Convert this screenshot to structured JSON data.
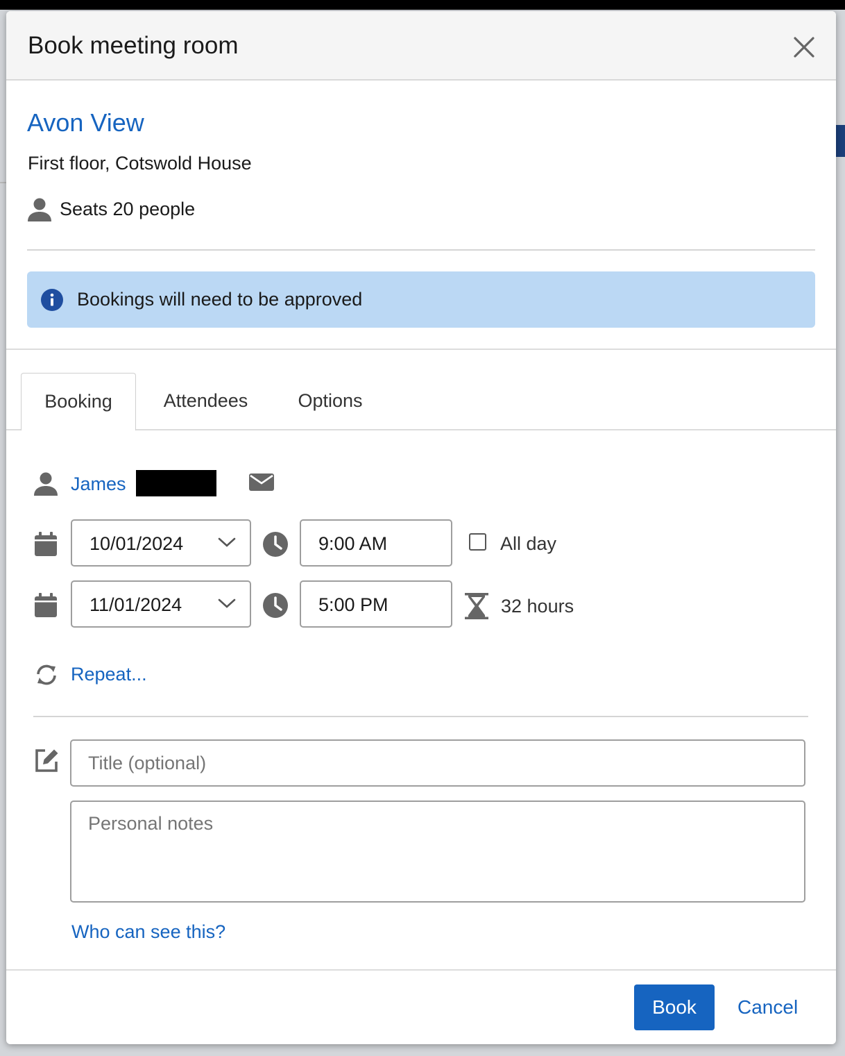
{
  "dialog": {
    "title": "Book meeting room",
    "close_icon": "close-icon"
  },
  "room": {
    "name": "Avon View",
    "location": "First floor, Cotswold House",
    "seats": "Seats 20 people",
    "seats_icon": "person-icon"
  },
  "info_banner": {
    "text": "Bookings will need to be approved",
    "icon": "info-icon",
    "background": "#bbd8f4"
  },
  "tabs": [
    {
      "label": "Booking",
      "active": true
    },
    {
      "label": "Attendees",
      "active": false
    },
    {
      "label": "Options",
      "active": false
    }
  ],
  "booking": {
    "organiser": "James",
    "start_date": "10/01/2024",
    "start_time": "9:00 AM",
    "all_day_label": "All day",
    "all_day_checked": false,
    "end_date": "11/01/2024",
    "end_time": "5:00 PM",
    "duration": "32 hours",
    "repeat_label": "Repeat...",
    "title_value": "",
    "title_placeholder": "Title (optional)",
    "notes_value": "",
    "notes_placeholder": "Personal notes",
    "who_can_see_label": "Who can see this?"
  },
  "footer": {
    "book_label": "Book",
    "cancel_label": "Cancel"
  },
  "colors": {
    "accent": "#1664c0",
    "header_bg": "#f5f5f5",
    "icon_gray": "#616161"
  }
}
